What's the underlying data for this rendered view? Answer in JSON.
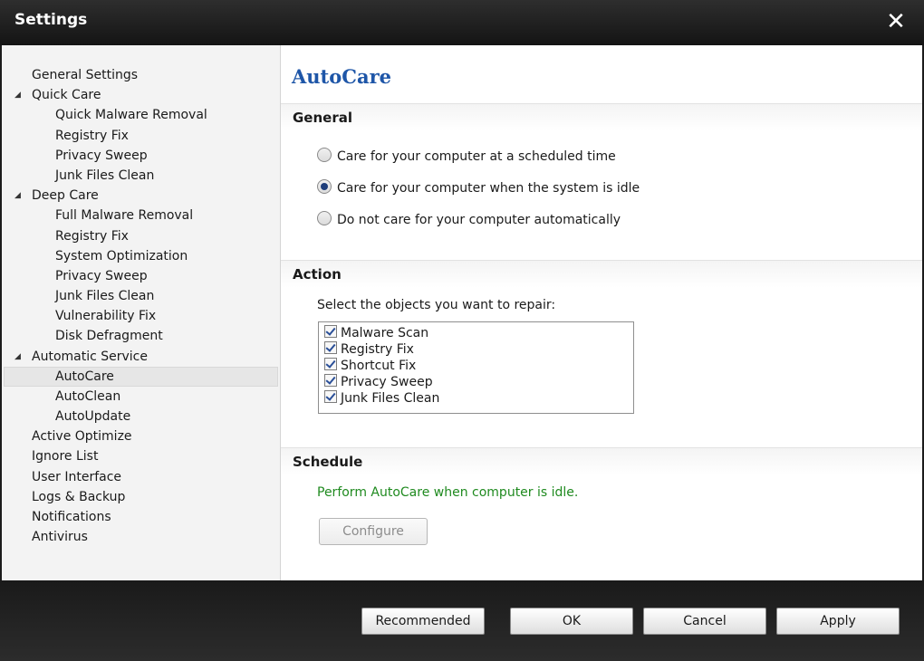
{
  "window": {
    "title": "Settings"
  },
  "sidebar": {
    "items": [
      {
        "label": "General Settings"
      },
      {
        "label": "Quick Care"
      },
      {
        "label": "Quick Malware Removal"
      },
      {
        "label": "Registry Fix"
      },
      {
        "label": "Privacy Sweep"
      },
      {
        "label": "Junk Files Clean"
      },
      {
        "label": "Deep Care"
      },
      {
        "label": "Full Malware Removal"
      },
      {
        "label": "Registry Fix"
      },
      {
        "label": "System Optimization"
      },
      {
        "label": "Privacy Sweep"
      },
      {
        "label": "Junk Files Clean"
      },
      {
        "label": "Vulnerability Fix"
      },
      {
        "label": "Disk Defragment"
      },
      {
        "label": "Automatic Service"
      },
      {
        "label": "AutoCare"
      },
      {
        "label": "AutoClean"
      },
      {
        "label": "AutoUpdate"
      },
      {
        "label": "Active Optimize"
      },
      {
        "label": "Ignore List"
      },
      {
        "label": "User Interface"
      },
      {
        "label": "Logs & Backup"
      },
      {
        "label": "Notifications"
      },
      {
        "label": "Antivirus"
      }
    ],
    "selected": "AutoCare"
  },
  "content": {
    "title": "AutoCare",
    "general": {
      "heading": "General",
      "options": [
        {
          "label": "Care for your computer at a scheduled time"
        },
        {
          "label": "Care for your computer when the system is idle"
        },
        {
          "label": "Do not care for your computer automatically"
        }
      ],
      "selected_option": "Care for your computer when the system is idle"
    },
    "action": {
      "heading": "Action",
      "prompt": "Select the objects you want to repair:",
      "items": [
        {
          "label": "Malware Scan"
        },
        {
          "label": "Registry Fix"
        },
        {
          "label": "Shortcut Fix"
        },
        {
          "label": "Privacy Sweep"
        },
        {
          "label": "Junk Files Clean"
        }
      ]
    },
    "schedule": {
      "heading": "Schedule",
      "status": "Perform AutoCare when computer is idle.",
      "configure_label": "Configure"
    }
  },
  "footer": {
    "recommended_label": "Recommended",
    "ok_label": "OK",
    "cancel_label": "Cancel",
    "apply_label": "Apply"
  },
  "colors": {
    "accent": "#1e56a8",
    "status_green": "#1f8a1f",
    "chrome": "#1b1b1b"
  },
  "icons": {
    "close": "close-icon",
    "tree_expand": "triangle-down-icon"
  }
}
